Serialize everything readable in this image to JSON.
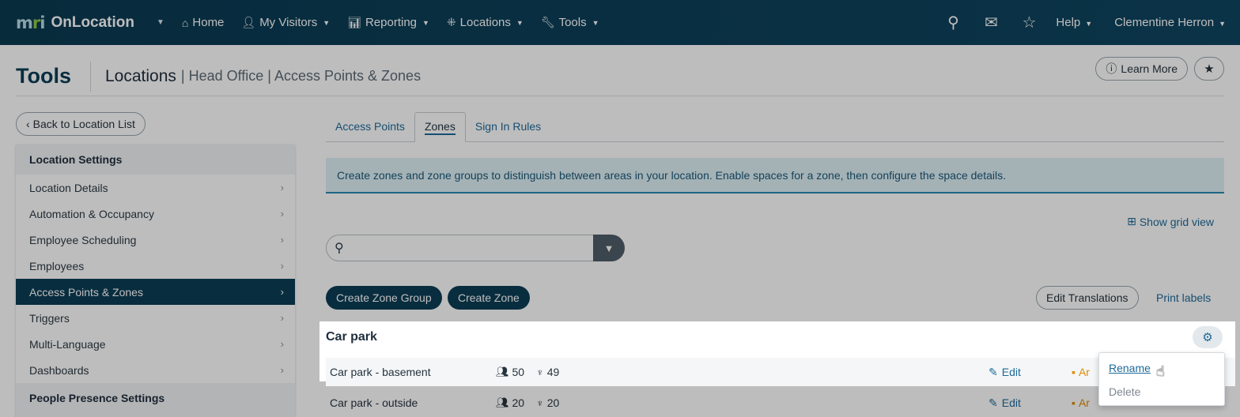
{
  "topnav": {
    "brand": "mri",
    "app_name": "OnLocation",
    "items": [
      {
        "label": "Home",
        "icon": "home-icon"
      },
      {
        "label": "My Visitors",
        "icon": "user-icon"
      },
      {
        "label": "Reporting",
        "icon": "bar-chart-icon"
      },
      {
        "label": "Locations",
        "icon": "network-icon"
      },
      {
        "label": "Tools",
        "icon": "wrench-icon"
      }
    ],
    "right": {
      "help": "Help",
      "user": "Clementine Herron"
    }
  },
  "header": {
    "title": "Tools",
    "crumb_main": "Locations",
    "crumb_rest": "| Head Office | Access Points & Zones",
    "learn_more": "Learn More"
  },
  "sidebar": {
    "back_label": "Back to Location List",
    "section1": "Location Settings",
    "items": [
      {
        "label": "Location Details",
        "active": false
      },
      {
        "label": "Automation & Occupancy",
        "active": false
      },
      {
        "label": "Employee Scheduling",
        "active": false
      },
      {
        "label": "Employees",
        "active": false
      },
      {
        "label": "Access Points & Zones",
        "active": true
      },
      {
        "label": "Triggers",
        "active": false
      },
      {
        "label": "Multi-Language",
        "active": false
      },
      {
        "label": "Dashboards",
        "active": false
      }
    ],
    "section2": "People Presence Settings"
  },
  "main": {
    "tabs": [
      "Access Points",
      "Zones",
      "Sign In Rules"
    ],
    "active_tab": "Zones",
    "info": "Create zones and zone groups to distinguish between areas in your location. Enable spaces for a zone, then configure the space details.",
    "grid_view": "Show grid view",
    "search_placeholder": "",
    "create_group": "Create Zone Group",
    "create_zone": "Create Zone",
    "edit_translations": "Edit Translations",
    "print_labels": "Print labels",
    "group": {
      "title": "Car park",
      "zones": [
        {
          "name": "Car park - basement",
          "capacity": "50",
          "desks": "49",
          "edit": "Edit",
          "archive": "Ar"
        },
        {
          "name": "Car park - outside",
          "capacity": "20",
          "desks": "20",
          "edit": "Edit",
          "archive": "Ar"
        }
      ]
    },
    "menu": {
      "rename": "Rename",
      "delete": "Delete"
    }
  }
}
